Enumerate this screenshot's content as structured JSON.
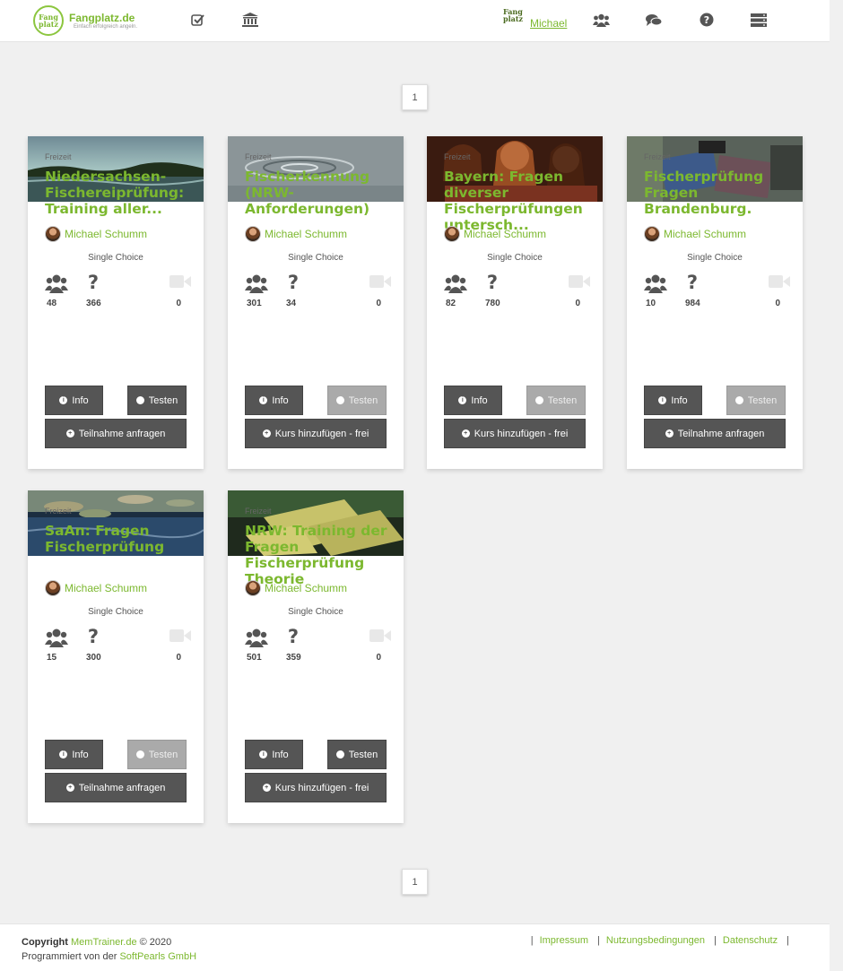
{
  "header": {
    "logo_line1": "Fang",
    "logo_line2": "platz",
    "brand_name": "Fangplatz.de",
    "brand_tagline": "Einfach erfolgreich angeln.",
    "user_name": "Michael",
    "icons": [
      "check-square-icon",
      "institution-icon",
      "users-icon",
      "comments-icon",
      "question-circle-icon",
      "server-menu-icon"
    ]
  },
  "pagination": {
    "top_page": "1",
    "bottom_page": "1"
  },
  "cards": [
    {
      "category": "Freizeit",
      "title": "Niedersachsen-Fischereiprüfung: Training aller...",
      "author": "Michael Schumm",
      "qtype": "Single Choice",
      "participants": "48",
      "questions": "366",
      "videos": "0",
      "info_label": "Info",
      "test_label": "Testen",
      "test_enabled": true,
      "action_label": "Teilnahme anfragen",
      "action_icon": "plus-circle-icon",
      "image": "lake-landscape"
    },
    {
      "category": "Freizeit",
      "title": "Fischerkennung (NRW-Anforderungen)",
      "author": "Michael Schumm",
      "qtype": "Single Choice",
      "participants": "301",
      "questions": "34",
      "videos": "0",
      "info_label": "Info",
      "test_label": "Testen",
      "test_enabled": false,
      "action_label": "Kurs hinzufügen - frei",
      "action_icon": "plus-circle-icon",
      "image": "water-ripples"
    },
    {
      "category": "Freizeit",
      "title": "Bayern: Fragen diverser Fischerprüfungen untersch...",
      "author": "Michael Schumm",
      "qtype": "Single Choice",
      "participants": "82",
      "questions": "780",
      "videos": "0",
      "info_label": "Info",
      "test_label": "Testen",
      "test_enabled": false,
      "action_label": "Kurs hinzufügen - frei",
      "action_icon": "plus-circle-icon",
      "image": "women-smartphones"
    },
    {
      "category": "Freizeit",
      "title": "Fischerprüfung Fragen Brandenburg.",
      "author": "Michael Schumm",
      "qtype": "Single Choice",
      "participants": "10",
      "questions": "984",
      "videos": "0",
      "info_label": "Info",
      "test_label": "Testen",
      "test_enabled": false,
      "action_label": "Teilnahme anfragen",
      "action_icon": "plus-circle-icon",
      "image": "fishing-gear"
    },
    {
      "category": "Freizeit",
      "title": "SaAn: Fragen Fischerprüfung",
      "author": "Michael Schumm",
      "qtype": "Single Choice",
      "participants": "15",
      "questions": "300",
      "videos": "0",
      "info_label": "Info",
      "test_label": "Testen",
      "test_enabled": false,
      "action_label": "Teilnahme anfragen",
      "action_icon": "plus-circle-icon",
      "image": "lily-pond"
    },
    {
      "category": "Freizeit",
      "title": "NRW: Training der Fragen Fischerprüfung Theorie",
      "author": "Michael Schumm",
      "qtype": "Single Choice",
      "participants": "501",
      "questions": "359",
      "videos": "0",
      "info_label": "Info",
      "test_label": "Testen",
      "test_enabled": true,
      "action_label": "Kurs hinzufügen - frei",
      "action_icon": "plus-circle-icon",
      "image": "exam-cards"
    }
  ],
  "footer": {
    "copyright_label": "Copyright",
    "site": "MemTrainer.de",
    "year": "© 2020",
    "programmed_by": "Programmiert von der",
    "company": "SoftPearls GmbH",
    "links": [
      "Impressum",
      "Nutzungsbedingungen",
      "Datenschutz"
    ]
  },
  "colors": {
    "accent": "#7cb82f",
    "button": "#555555",
    "button_disabled": "#aaaaaa",
    "background": "#f0f0f0"
  }
}
